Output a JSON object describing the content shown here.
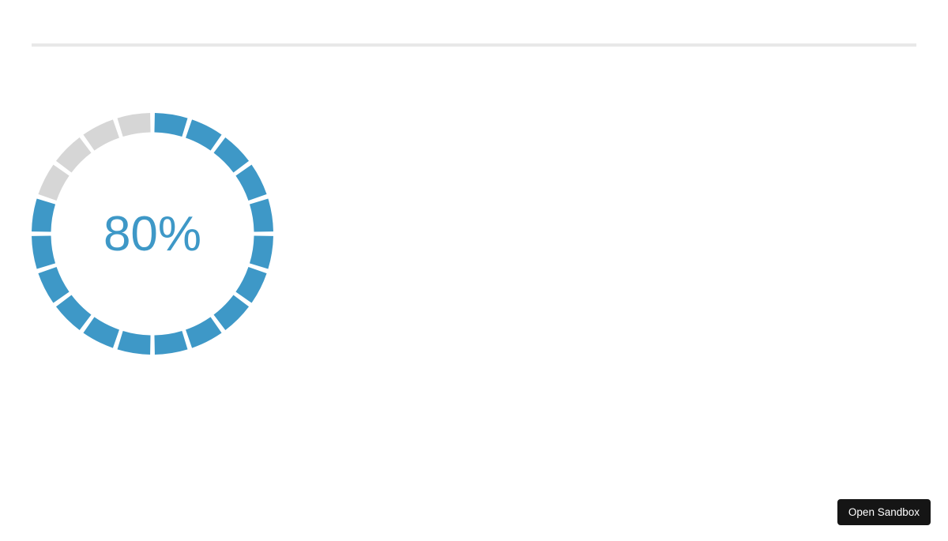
{
  "chart_data": {
    "type": "pie",
    "value": 80,
    "max": 100,
    "label": "80%",
    "segments_total": 20,
    "segments_filled": 16,
    "colors": {
      "filled": "#3e98c7",
      "empty": "#d6d6d6",
      "text": "#3e98c7"
    }
  },
  "sandbox": {
    "open_label": "Open Sandbox"
  }
}
